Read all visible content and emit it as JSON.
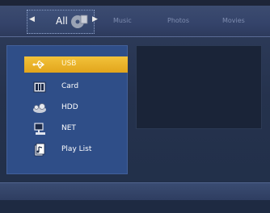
{
  "tabs": {
    "all": "All",
    "music": "Music",
    "photos": "Photos",
    "movies": "Movies"
  },
  "arrows": {
    "left": "◀",
    "right": "▶"
  },
  "menu": {
    "selected_index": 0,
    "items": [
      {
        "label": "USB",
        "icon": "usb-icon"
      },
      {
        "label": "Card",
        "icon": "card-icon"
      },
      {
        "label": "HDD",
        "icon": "hdd-icon"
      },
      {
        "label": "NET",
        "icon": "network-icon"
      },
      {
        "label": "Play List",
        "icon": "playlist-icon"
      }
    ]
  },
  "colors": {
    "selected": "#e9b12a",
    "panel": "#2f4e88",
    "background": "#26324c"
  }
}
